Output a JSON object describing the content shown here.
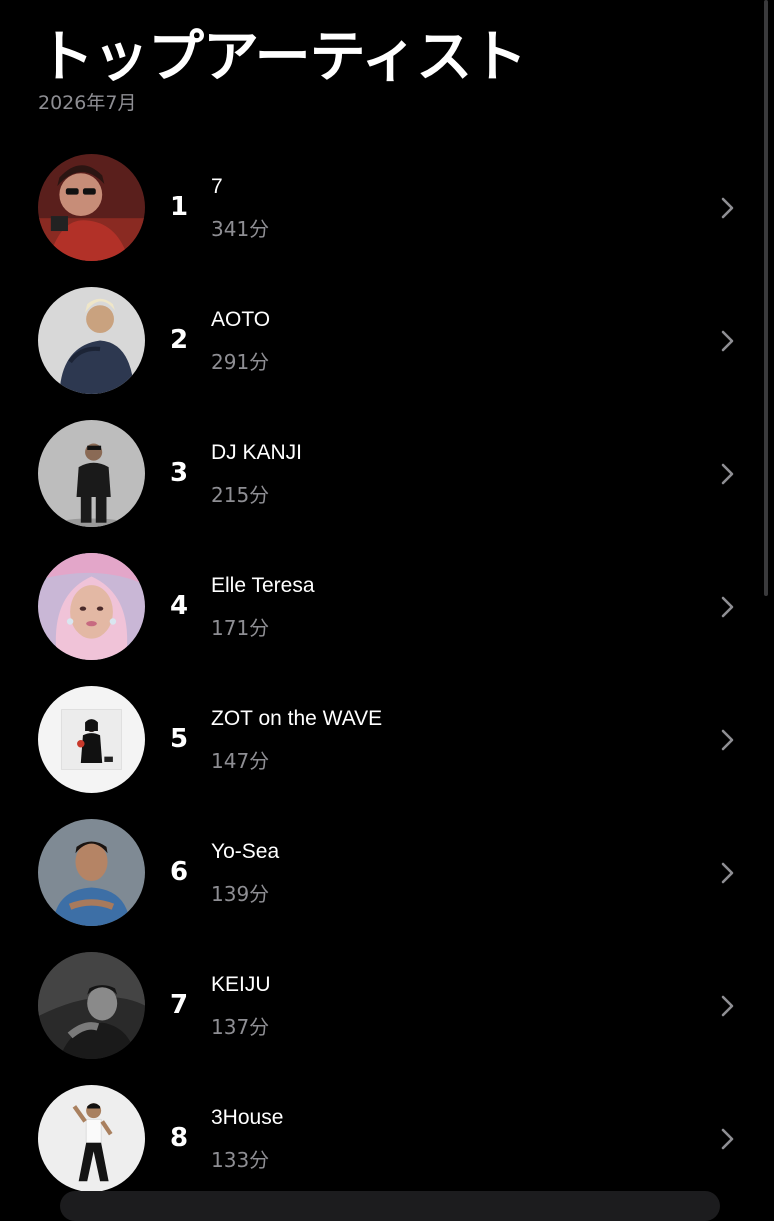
{
  "header": {
    "title": "トップアーティスト",
    "subtitle": "2026年7月"
  },
  "artists": [
    {
      "rank": "1",
      "name": "7",
      "minutes": "341分",
      "avatar": "portrait-red-woman-sunglasses"
    },
    {
      "rank": "2",
      "name": "AOTO",
      "minutes": "291分",
      "avatar": "portrait-blonde-braids-denim"
    },
    {
      "rank": "3",
      "name": "DJ KANJI",
      "minutes": "215分",
      "avatar": "portrait-man-black-outfit"
    },
    {
      "rank": "4",
      "name": "Elle Teresa",
      "minutes": "171分",
      "avatar": "portrait-pink-hair-woman"
    },
    {
      "rank": "5",
      "name": "ZOT on the WAVE",
      "minutes": "147分",
      "avatar": "album-cover-woman-apple"
    },
    {
      "rank": "6",
      "name": "Yo-Sea",
      "minutes": "139分",
      "avatar": "portrait-man-blue-shirt"
    },
    {
      "rank": "7",
      "name": "KEIJU",
      "minutes": "137分",
      "avatar": "portrait-monochrome-man"
    },
    {
      "rank": "8",
      "name": "3House",
      "minutes": "133分",
      "avatar": "portrait-man-white-tank"
    }
  ],
  "icons": {
    "chevron": "chevron-right-icon"
  },
  "colors": {
    "background": "#000000",
    "primary_text": "#ffffff",
    "secondary_text": "#8e8e93",
    "chevron": "#8e8e93"
  }
}
